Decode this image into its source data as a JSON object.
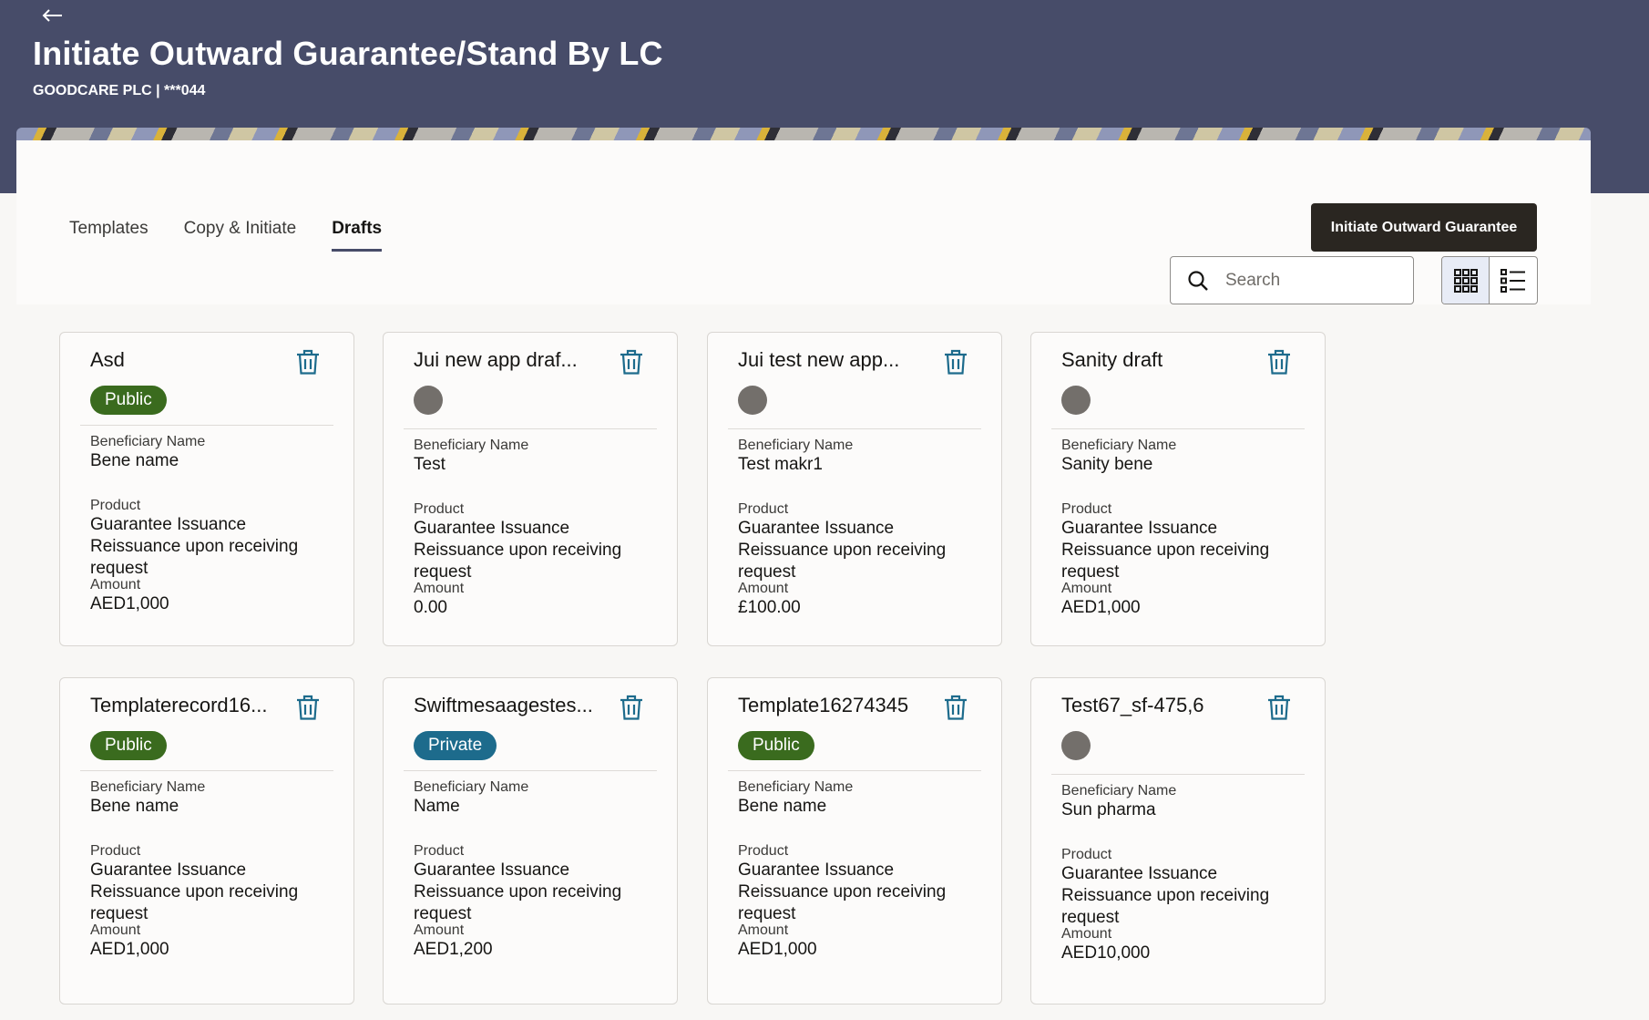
{
  "header": {
    "title": "Initiate Outward Guarantee/Stand By LC",
    "subtitle": "GOODCARE PLC | ***044"
  },
  "tabs": [
    {
      "label": "Templates"
    },
    {
      "label": "Copy & Initiate"
    },
    {
      "label": "Drafts"
    }
  ],
  "toolbar": {
    "initiate_label": "Initiate Outward Guarantee",
    "search_placeholder": "Search",
    "search_value": ""
  },
  "field_labels": {
    "beneficiary": "Beneficiary Name",
    "product": "Product",
    "amount": "Amount"
  },
  "cards": [
    {
      "name": "Asd",
      "visibility": "Public",
      "beneficiary": "Bene name",
      "product": "Guarantee Issuance Reissuance upon receiving request",
      "amount": "AED1,000"
    },
    {
      "name": "Jui new app draf...",
      "visibility": "",
      "beneficiary": "Test",
      "product": "Guarantee Issuance  Reissuance upon receiving request",
      "amount": "0.00"
    },
    {
      "name": "Jui test new app...",
      "visibility": "",
      "beneficiary": "Test makr1",
      "product": "Guarantee Issuance  Reissuance upon receiving request",
      "amount": "£100.00"
    },
    {
      "name": "Sanity draft",
      "visibility": "",
      "beneficiary": "Sanity bene",
      "product": "Guarantee Issuance  Reissuance upon receiving request",
      "amount": "AED1,000"
    },
    {
      "name": "Templaterecord16...",
      "visibility": "Public",
      "beneficiary": "Bene name",
      "product": "Guarantee Issuance Reissuance upon receiving request",
      "amount": "AED1,000"
    },
    {
      "name": "Swiftmesaagestes...",
      "visibility": "Private",
      "beneficiary": "Name",
      "product": "Guarantee Issuance  Reissuance upon receiving request",
      "amount": "AED1,200"
    },
    {
      "name": "Template16274345",
      "visibility": "Public",
      "beneficiary": "Bene name",
      "product": "Guarantee Issuance Reissuance upon receiving request",
      "amount": "AED1,000"
    },
    {
      "name": "Test67_sf-475,6",
      "visibility": "",
      "beneficiary": "Sun pharma",
      "product": "Guarantee Issuance  Reissuance upon receiving request",
      "amount": "AED10,000"
    }
  ],
  "icons": {
    "back": "arrow-left-icon",
    "search": "search-icon",
    "grid_view": "grid-view-icon",
    "list_view": "list-view-icon",
    "delete": "trash-icon"
  },
  "colors": {
    "header_bg": "#474c69",
    "primary_button": "#2a2621",
    "public_badge": "#3a6b1e",
    "private_badge": "#1d6b8c",
    "trash_icon": "#1d6b8c"
  }
}
